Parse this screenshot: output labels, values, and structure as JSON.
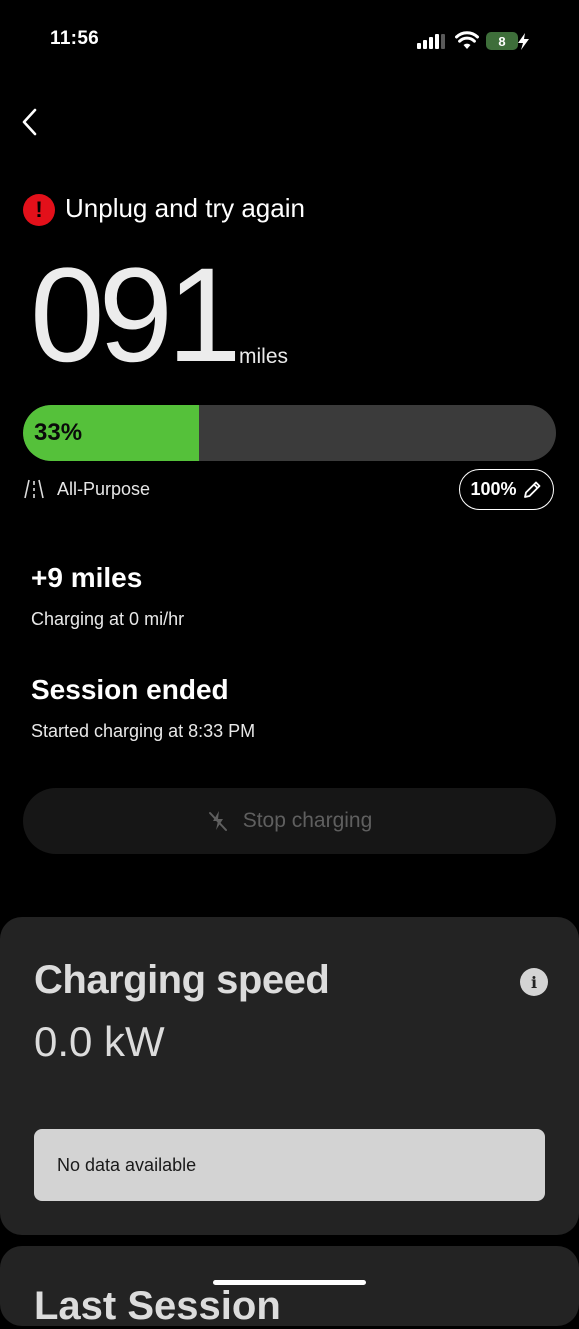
{
  "status_bar": {
    "time": "11:56",
    "battery_level": "8",
    "battery_color": "#3e6e3a"
  },
  "alert": {
    "icon": "!",
    "message": "Unplug and try again",
    "color": "#e3101a"
  },
  "range": {
    "value": "091",
    "unit": "miles"
  },
  "battery": {
    "percent_label": "33%",
    "fill_percent": 33,
    "fill_color": "#55c13a",
    "mode_label": "All-Purpose",
    "limit_label": "100%"
  },
  "stats": {
    "miles_added": "+9 miles",
    "charging_rate": "Charging at 0 mi/hr",
    "session_state": "Session ended",
    "session_start": "Started charging at 8:33 PM"
  },
  "actions": {
    "stop_label": "Stop charging"
  },
  "charging_speed_card": {
    "title": "Charging speed",
    "info_icon": "i",
    "value": "0.0 kW",
    "empty_message": "No data available"
  },
  "next_card": {
    "title_partial": "Last Session"
  },
  "icons": {
    "back": "chevron-left-icon",
    "mode": "road-icon",
    "edit": "pencil-icon",
    "stop": "charging-slash-icon",
    "info": "info-icon"
  }
}
